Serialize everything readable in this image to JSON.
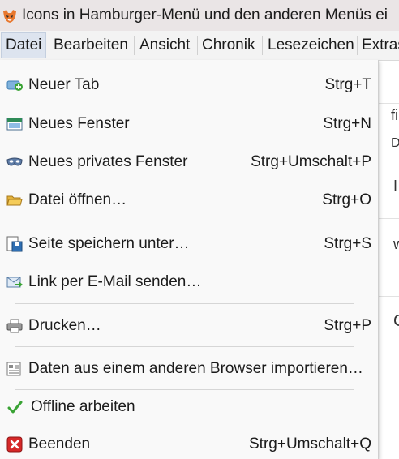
{
  "window": {
    "title": "Icons in Hamburger-Menü und den anderen Menüs ei"
  },
  "menubar": {
    "items": [
      {
        "label": "Datei",
        "active": true
      },
      {
        "label": "Bearbeiten"
      },
      {
        "label": "Ansicht"
      },
      {
        "label": "Chronik"
      },
      {
        "label": "Lesezeichen"
      },
      {
        "label": "Extras"
      }
    ]
  },
  "background_fragments": [
    "fi",
    "D",
    "I",
    "w",
    "C"
  ],
  "file_menu": {
    "items": [
      {
        "label": "Neuer Tab",
        "shortcut": "Strg+T",
        "icon": "new-tab-icon"
      },
      {
        "label": "Neues Fenster",
        "shortcut": "Strg+N",
        "icon": "new-window-icon"
      },
      {
        "label": "Neues privates Fenster",
        "shortcut": "Strg+Umschalt+P",
        "icon": "private-window-mask-icon"
      },
      {
        "label": "Datei öffnen…",
        "shortcut": "Strg+O",
        "icon": "folder-open-icon"
      },
      {
        "label": "Seite speichern unter…",
        "shortcut": "Strg+S",
        "icon": "save-page-icon"
      },
      {
        "label": "Link per E-Mail senden…",
        "shortcut": "",
        "icon": "email-link-icon"
      },
      {
        "label": "Drucken…",
        "shortcut": "Strg+P",
        "icon": "printer-icon"
      },
      {
        "label": "Daten aus einem anderen Browser importieren…",
        "shortcut": "",
        "icon": "import-data-icon"
      },
      {
        "label": "Offline arbeiten",
        "shortcut": "",
        "icon": "checkmark-icon"
      },
      {
        "label": "Beenden",
        "shortcut": "Strg+Umschalt+Q",
        "icon": "quit-icon"
      }
    ]
  },
  "colors": {
    "title_bar": "#eae5e6",
    "menu_bar": "#f3f3f3",
    "menu_background": "#f9f9f9",
    "active_menu_highlight": "#dde4ef",
    "quit_red": "#d62828",
    "check_green": "#3aa335"
  }
}
